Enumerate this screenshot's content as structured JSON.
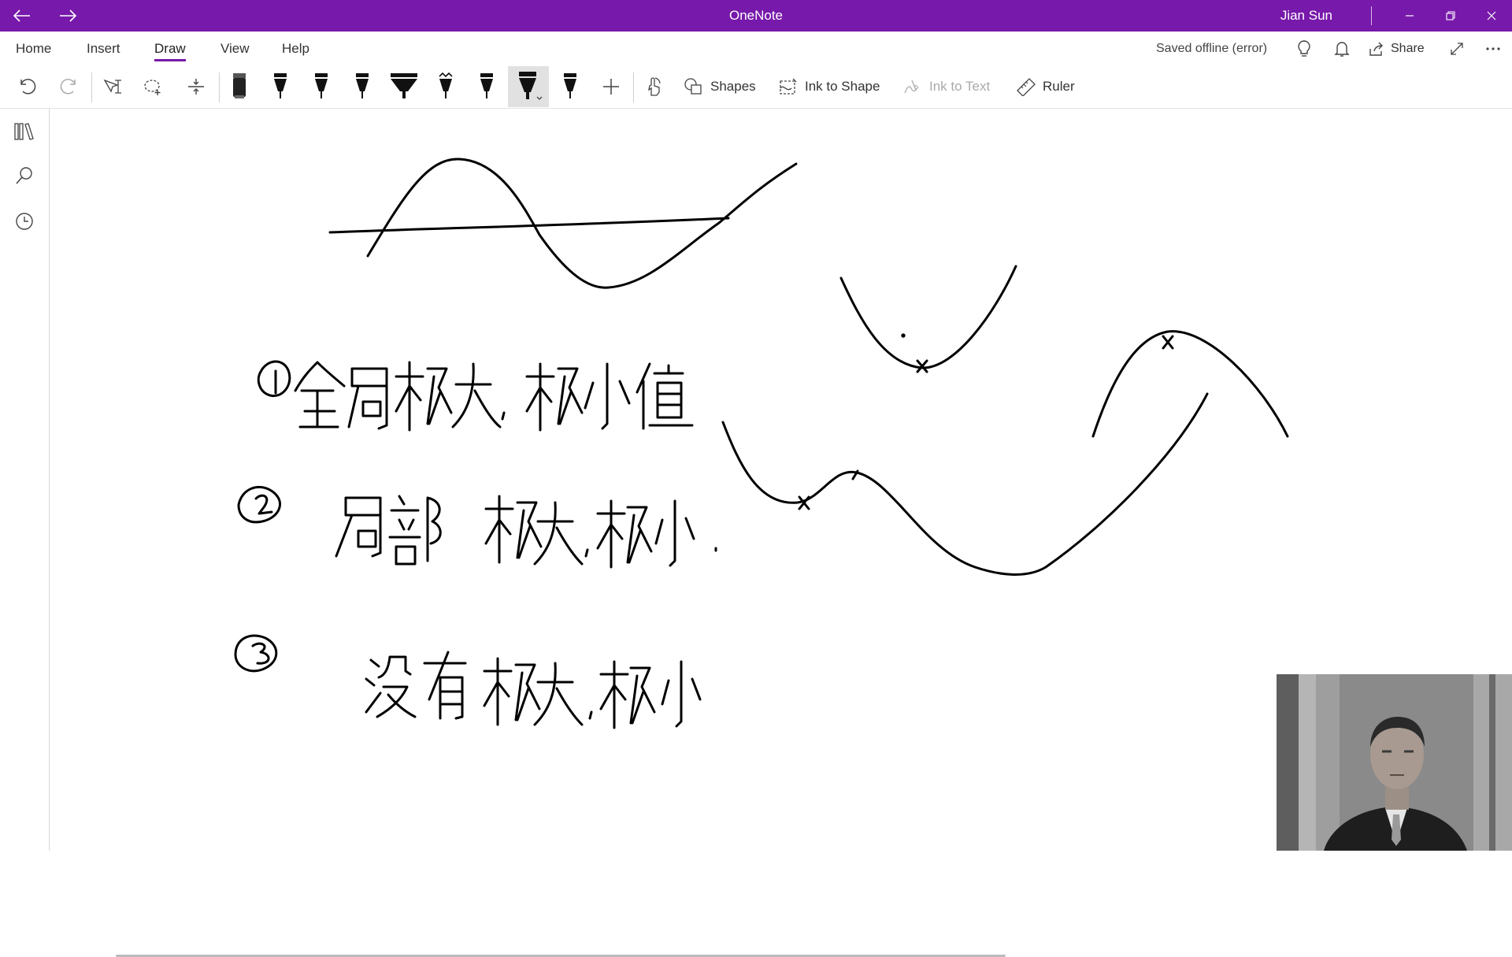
{
  "titlebar": {
    "app_title": "OneNote",
    "user_name": "Jian Sun",
    "accent_color": "#7719aa",
    "icons": [
      "back-arrow-icon",
      "forward-arrow-icon",
      "minimize-icon",
      "restore-icon",
      "close-icon"
    ]
  },
  "ribbon": {
    "tabs": [
      {
        "label": "Home",
        "active": false
      },
      {
        "label": "Insert",
        "active": false
      },
      {
        "label": "Draw",
        "active": true
      },
      {
        "label": "View",
        "active": false
      },
      {
        "label": "Help",
        "active": false
      }
    ],
    "status": "Saved offline (error)",
    "share_label": "Share",
    "icons": [
      "lightbulb-icon",
      "bell-icon",
      "share-icon",
      "expand-icon",
      "more-icon"
    ]
  },
  "toolbar": {
    "shapes_label": "Shapes",
    "ink_to_shape_label": "Ink to Shape",
    "ink_to_text_label": "Ink to Text",
    "ruler_label": "Ruler",
    "selected_pen_index": 7,
    "icons": [
      "undo-icon",
      "redo-icon",
      "type-select-icon",
      "lasso-select-icon",
      "insert-space-icon",
      "eraser-icon",
      "pen-icon",
      "add-pen-icon",
      "touch-draw-icon",
      "shapes-icon",
      "ink-to-shape-icon",
      "ink-to-text-icon",
      "ruler-icon"
    ]
  },
  "sidebar": {
    "icons": [
      "notebooks-icon",
      "search-icon",
      "recent-icon"
    ]
  },
  "webcam": {
    "description": "presenter video overlay"
  }
}
